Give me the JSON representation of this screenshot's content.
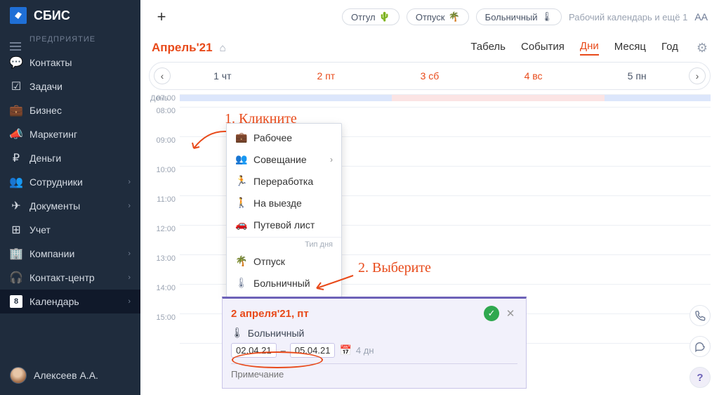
{
  "app": {
    "name": "СБИС",
    "section": "ПРЕДПРИЯТИЕ"
  },
  "sidebar": {
    "items": [
      {
        "label": "Контакты"
      },
      {
        "label": "Задачи"
      },
      {
        "label": "Бизнес"
      },
      {
        "label": "Маркетинг"
      },
      {
        "label": "Деньги"
      },
      {
        "label": "Сотрудники"
      },
      {
        "label": "Документы"
      },
      {
        "label": "Учет"
      },
      {
        "label": "Компании"
      },
      {
        "label": "Контакт-центр"
      },
      {
        "label": "Календарь",
        "badge": "8"
      }
    ],
    "user": "Алексеев А.А."
  },
  "topbar": {
    "chips": [
      {
        "label": "Отгул",
        "icon": "🌵"
      },
      {
        "label": "Отпуск",
        "icon": "🌴"
      },
      {
        "label": "Больничный",
        "icon": "🌡"
      }
    ],
    "right_label": "Рабочий календарь и ещё 1"
  },
  "header": {
    "month": "Апрель'21",
    "tabs": [
      "Табель",
      "События",
      "Дни",
      "Месяц",
      "Год"
    ],
    "active_tab": 2
  },
  "days": [
    "1 чт",
    "2 пт",
    "3 сб",
    "4 вс",
    "5 пн"
  ],
  "time_header": "День",
  "times": [
    "07:00",
    "08:00",
    "09:00",
    "10:00",
    "11:00",
    "12:00",
    "13:00",
    "14:00",
    "15:00"
  ],
  "context_menu": {
    "group1": [
      {
        "label": "Рабочее",
        "icon": "💼"
      },
      {
        "label": "Совещание",
        "icon": "👥",
        "submenu": true
      },
      {
        "label": "Переработка",
        "icon": "🏃"
      },
      {
        "label": "На выезде",
        "icon": "🚶"
      },
      {
        "label": "Путевой лист",
        "icon": "🚗"
      }
    ],
    "section_label": "Тип дня",
    "group2": [
      {
        "label": "Отпуск",
        "icon": "🌴"
      },
      {
        "label": "Больничный",
        "icon": "🌡"
      }
    ]
  },
  "popup": {
    "title": "2 апреля'21, пт",
    "type_label": "Больничный",
    "date_from": "02.04.21",
    "date_to": "05.04.21",
    "duration": "4 дн",
    "note_placeholder": "Примечание"
  },
  "annotations": {
    "step1": "1. Кликните",
    "step2": "2. Выберите"
  },
  "help_glyph": "?"
}
